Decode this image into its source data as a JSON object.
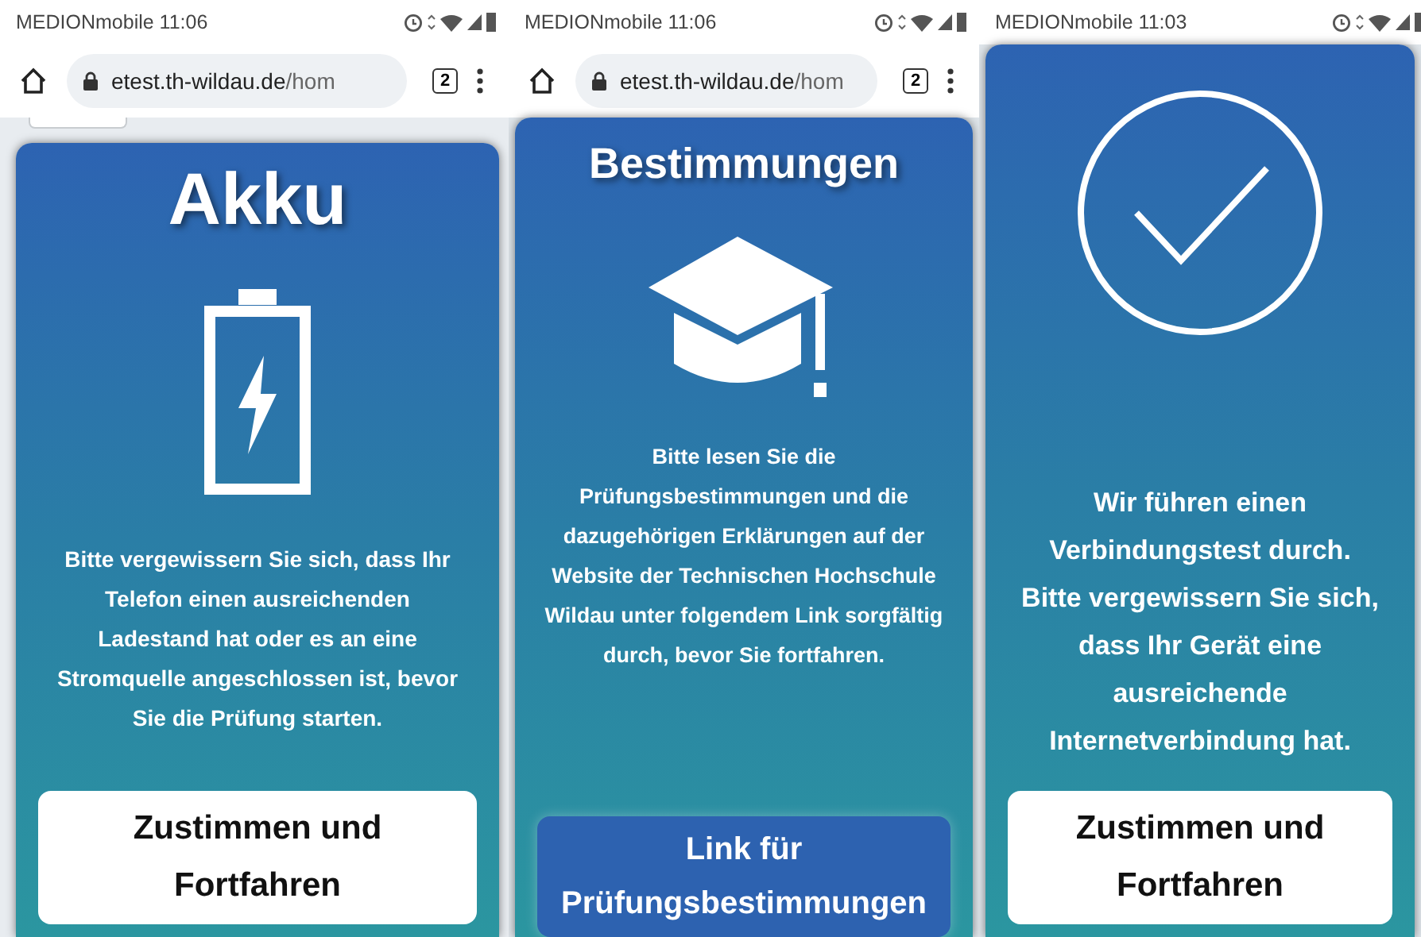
{
  "phones": [
    {
      "status_bar": {
        "carrier": "MEDIONmobile",
        "time": "11:06"
      },
      "browser_bar": {
        "url_host": "etest.th-wildau.de",
        "url_path": "/hom",
        "tab_count": "2"
      },
      "scrolled": true,
      "card": {
        "kind": "battery",
        "title": "Akku",
        "message": "Bitte vergewissern Sie sich, dass Ihr Telefon einen ausreichenden Ladestand hat oder es an eine Stromquelle angeschlossen ist, bevor Sie die Prüfung starten.",
        "button": {
          "kind": "light",
          "label": "Zustimmen und Fortfahren"
        }
      }
    },
    {
      "status_bar": {
        "carrier": "MEDIONmobile",
        "time": "11:06"
      },
      "browser_bar": {
        "url_host": "etest.th-wildau.de",
        "url_path": "/hom",
        "tab_count": "2"
      },
      "scrolled": false,
      "card": {
        "kind": "rules",
        "title": "Bestimmungen",
        "message": "Bitte lesen Sie die Prüfungsbestimmungen und die dazugehörigen Erklärungen auf der Website der Technischen Hochschule Wildau unter folgendem Link sorgfältig durch, bevor Sie fortfahren.",
        "button": {
          "kind": "dark",
          "label": "Link für Prüfungsbestimmungen"
        }
      }
    },
    {
      "status_bar": {
        "carrier": "MEDIONmobile",
        "time": "11:03"
      },
      "scrolled": false,
      "card": {
        "kind": "connection",
        "message": "Wir führen einen Verbindungstest durch. Bitte vergewissern Sie sich, dass Ihr Gerät eine ausreichende Internetverbindung hat.",
        "button": {
          "kind": "light",
          "label": "Zustimmen und Fortfahren"
        }
      }
    }
  ]
}
